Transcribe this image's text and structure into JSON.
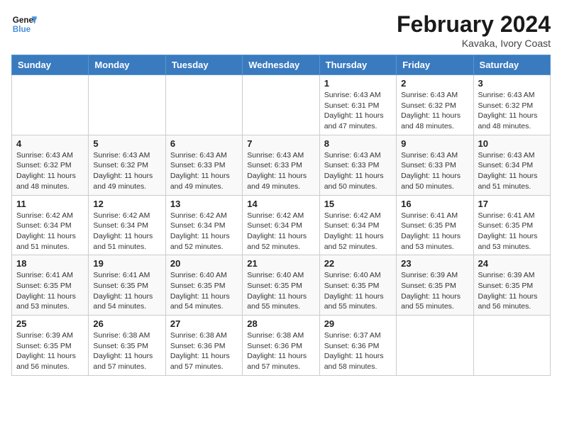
{
  "header": {
    "logo_general": "General",
    "logo_blue": "Blue",
    "month_title": "February 2024",
    "subtitle": "Kavaka, Ivory Coast"
  },
  "weekdays": [
    "Sunday",
    "Monday",
    "Tuesday",
    "Wednesday",
    "Thursday",
    "Friday",
    "Saturday"
  ],
  "weeks": [
    [
      {
        "day": "",
        "info": ""
      },
      {
        "day": "",
        "info": ""
      },
      {
        "day": "",
        "info": ""
      },
      {
        "day": "",
        "info": ""
      },
      {
        "day": "1",
        "info": "Sunrise: 6:43 AM\nSunset: 6:31 PM\nDaylight: 11 hours and 47 minutes."
      },
      {
        "day": "2",
        "info": "Sunrise: 6:43 AM\nSunset: 6:32 PM\nDaylight: 11 hours and 48 minutes."
      },
      {
        "day": "3",
        "info": "Sunrise: 6:43 AM\nSunset: 6:32 PM\nDaylight: 11 hours and 48 minutes."
      }
    ],
    [
      {
        "day": "4",
        "info": "Sunrise: 6:43 AM\nSunset: 6:32 PM\nDaylight: 11 hours and 48 minutes."
      },
      {
        "day": "5",
        "info": "Sunrise: 6:43 AM\nSunset: 6:32 PM\nDaylight: 11 hours and 49 minutes."
      },
      {
        "day": "6",
        "info": "Sunrise: 6:43 AM\nSunset: 6:33 PM\nDaylight: 11 hours and 49 minutes."
      },
      {
        "day": "7",
        "info": "Sunrise: 6:43 AM\nSunset: 6:33 PM\nDaylight: 11 hours and 49 minutes."
      },
      {
        "day": "8",
        "info": "Sunrise: 6:43 AM\nSunset: 6:33 PM\nDaylight: 11 hours and 50 minutes."
      },
      {
        "day": "9",
        "info": "Sunrise: 6:43 AM\nSunset: 6:33 PM\nDaylight: 11 hours and 50 minutes."
      },
      {
        "day": "10",
        "info": "Sunrise: 6:43 AM\nSunset: 6:34 PM\nDaylight: 11 hours and 51 minutes."
      }
    ],
    [
      {
        "day": "11",
        "info": "Sunrise: 6:42 AM\nSunset: 6:34 PM\nDaylight: 11 hours and 51 minutes."
      },
      {
        "day": "12",
        "info": "Sunrise: 6:42 AM\nSunset: 6:34 PM\nDaylight: 11 hours and 51 minutes."
      },
      {
        "day": "13",
        "info": "Sunrise: 6:42 AM\nSunset: 6:34 PM\nDaylight: 11 hours and 52 minutes."
      },
      {
        "day": "14",
        "info": "Sunrise: 6:42 AM\nSunset: 6:34 PM\nDaylight: 11 hours and 52 minutes."
      },
      {
        "day": "15",
        "info": "Sunrise: 6:42 AM\nSunset: 6:34 PM\nDaylight: 11 hours and 52 minutes."
      },
      {
        "day": "16",
        "info": "Sunrise: 6:41 AM\nSunset: 6:35 PM\nDaylight: 11 hours and 53 minutes."
      },
      {
        "day": "17",
        "info": "Sunrise: 6:41 AM\nSunset: 6:35 PM\nDaylight: 11 hours and 53 minutes."
      }
    ],
    [
      {
        "day": "18",
        "info": "Sunrise: 6:41 AM\nSunset: 6:35 PM\nDaylight: 11 hours and 53 minutes."
      },
      {
        "day": "19",
        "info": "Sunrise: 6:41 AM\nSunset: 6:35 PM\nDaylight: 11 hours and 54 minutes."
      },
      {
        "day": "20",
        "info": "Sunrise: 6:40 AM\nSunset: 6:35 PM\nDaylight: 11 hours and 54 minutes."
      },
      {
        "day": "21",
        "info": "Sunrise: 6:40 AM\nSunset: 6:35 PM\nDaylight: 11 hours and 55 minutes."
      },
      {
        "day": "22",
        "info": "Sunrise: 6:40 AM\nSunset: 6:35 PM\nDaylight: 11 hours and 55 minutes."
      },
      {
        "day": "23",
        "info": "Sunrise: 6:39 AM\nSunset: 6:35 PM\nDaylight: 11 hours and 55 minutes."
      },
      {
        "day": "24",
        "info": "Sunrise: 6:39 AM\nSunset: 6:35 PM\nDaylight: 11 hours and 56 minutes."
      }
    ],
    [
      {
        "day": "25",
        "info": "Sunrise: 6:39 AM\nSunset: 6:35 PM\nDaylight: 11 hours and 56 minutes."
      },
      {
        "day": "26",
        "info": "Sunrise: 6:38 AM\nSunset: 6:35 PM\nDaylight: 11 hours and 57 minutes."
      },
      {
        "day": "27",
        "info": "Sunrise: 6:38 AM\nSunset: 6:36 PM\nDaylight: 11 hours and 57 minutes."
      },
      {
        "day": "28",
        "info": "Sunrise: 6:38 AM\nSunset: 6:36 PM\nDaylight: 11 hours and 57 minutes."
      },
      {
        "day": "29",
        "info": "Sunrise: 6:37 AM\nSunset: 6:36 PM\nDaylight: 11 hours and 58 minutes."
      },
      {
        "day": "",
        "info": ""
      },
      {
        "day": "",
        "info": ""
      }
    ]
  ]
}
